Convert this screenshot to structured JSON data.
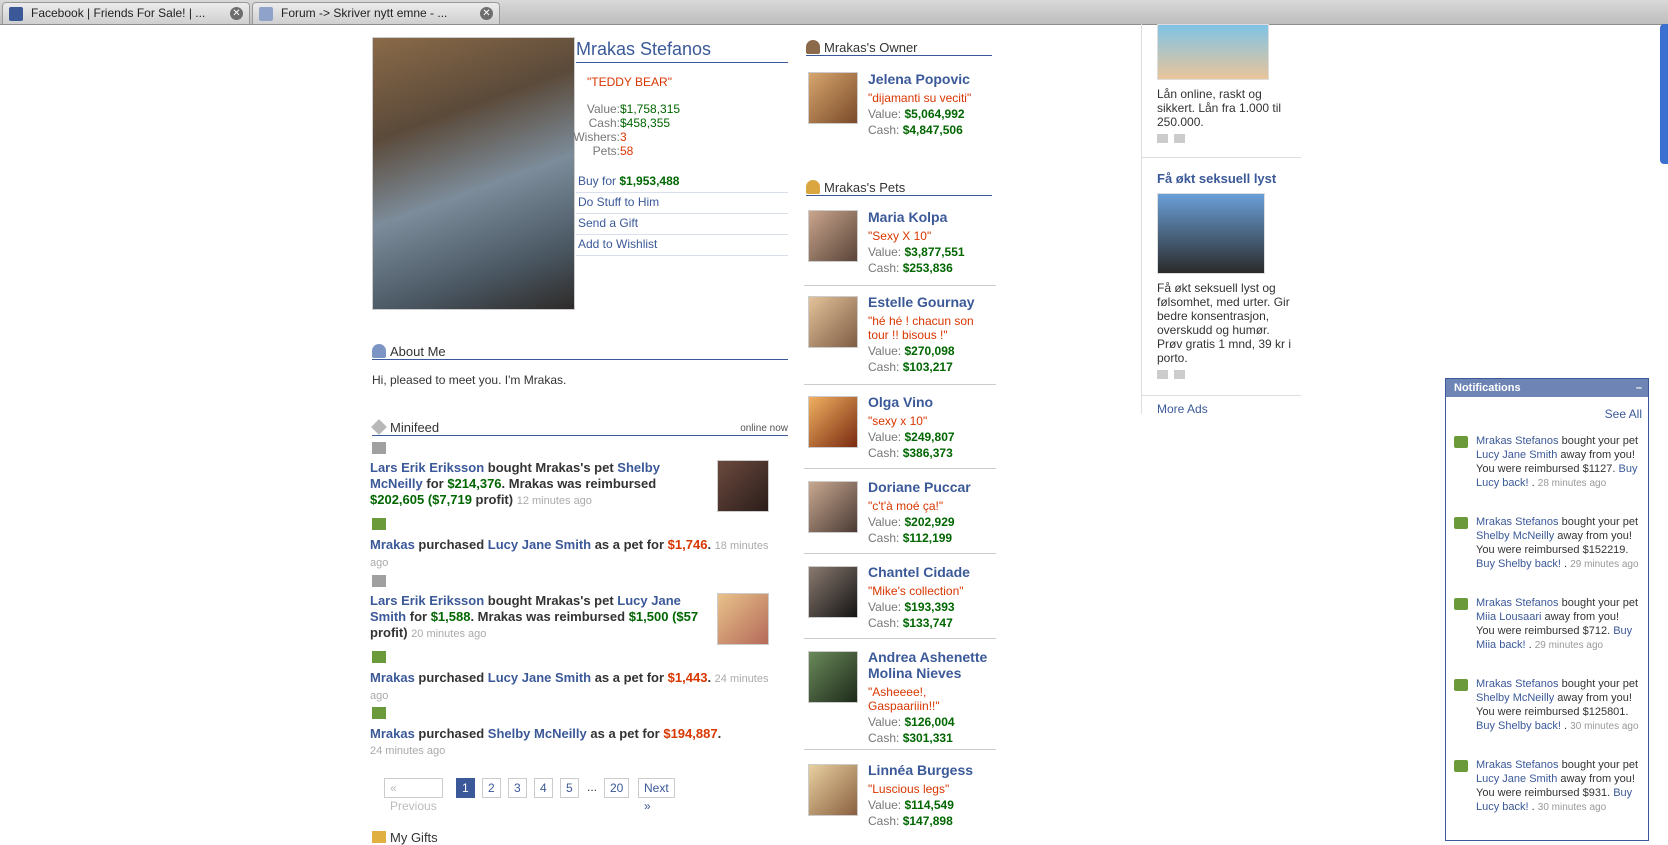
{
  "tabs": [
    {
      "title": "Facebook | Friends For Sale! | ..."
    },
    {
      "title": "Forum -> Skriver nytt emne - ..."
    }
  ],
  "profile": {
    "name": "Mrakas Stefanos",
    "nickname": "\"TEDDY BEAR\"",
    "stats": [
      {
        "label": "Value:",
        "value": "$1,758,315"
      },
      {
        "label": "Cash:",
        "value": "$458,355"
      },
      {
        "label": "Wishers:",
        "value": "3"
      },
      {
        "label": "Pets:",
        "value": "58"
      }
    ],
    "actions": {
      "buy_prefix": "Buy for ",
      "buy_price": "$1,953,488",
      "do_stuff": "Do Stuff to Him",
      "send_gift": "Send a Gift",
      "wishlist": "Add to Wishlist"
    }
  },
  "about": {
    "heading": "About Me",
    "text": "Hi, pleased to meet you. I'm Mrakas."
  },
  "minifeed": {
    "heading": "Minifeed",
    "status": "online now",
    "items": [
      {
        "actor": "Lars Erik Eriksson",
        "t1": " bought Mrakas's pet ",
        "pet": "Shelby McNeilly",
        "t2": " for ",
        "price": "$214,376",
        "t3": ". Mrakas was reimbursed ",
        "reimb": "$202,605 ($7,719",
        "t4": " profit) ",
        "ts": "12 minutes ago"
      },
      {
        "actor": "Mrakas",
        "t1": " purchased ",
        "pet": "Lucy Jane Smith",
        "t2": " as a pet for ",
        "price": "$1,746",
        "t3": ". ",
        "ts": "18 minutes ago"
      },
      {
        "actor": "Lars Erik Eriksson",
        "t1": " bought Mrakas's pet ",
        "pet": "Lucy Jane Smith",
        "t2": " for ",
        "price": "$1,588",
        "t3": ". Mrakas was reimbursed ",
        "reimb": "$1,500 ($57",
        "t4": " profit) ",
        "ts": "20 minutes ago"
      },
      {
        "actor": "Mrakas",
        "t1": " purchased ",
        "pet": "Lucy Jane Smith",
        "t2": " as a pet for ",
        "price": "$1,443",
        "t3": ". ",
        "ts": "24 minutes ago"
      },
      {
        "actor": "Mrakas",
        "t1": " purchased ",
        "pet": "Shelby McNeilly",
        "t2": " as a pet for ",
        "price": "$194,887",
        "t3": ".",
        "ts": "24 minutes ago"
      }
    ]
  },
  "pager": {
    "prev": "« Previous",
    "pages": [
      "1",
      "2",
      "3",
      "4",
      "5"
    ],
    "ellipsis": "...",
    "last": "20",
    "next": "Next »"
  },
  "gifts_heading": "My Gifts",
  "owner": {
    "heading": "Mrakas's Owner",
    "name": "Jelena Popovic",
    "quote": "\"dijamanti su veciti\"",
    "value_label": "Value:",
    "value": "$5,064,992",
    "cash_label": "Cash:",
    "cash": "$4,847,506"
  },
  "pets": {
    "heading": "Mrakas's Pets",
    "items": [
      {
        "name": "Maria Kolpa",
        "quote": "\"Sexy X 10\"",
        "value": "$3,877,551",
        "cash": "$253,836"
      },
      {
        "name": "Estelle Gournay",
        "quote": "\"hé hé ! chacun son tour !! bisous !\"",
        "value": "$270,098",
        "cash": "$103,217"
      },
      {
        "name": "Olga Vino",
        "quote": "\"sexy x 10\"",
        "value": "$249,807",
        "cash": "$386,373"
      },
      {
        "name": "Doriane Puccar",
        "quote": "\"c't'à moé ça!\"",
        "value": "$202,929",
        "cash": "$112,199"
      },
      {
        "name": "Chantel Cidade",
        "quote": "\"Mike's collection\"",
        "value": "$193,393",
        "cash": "$133,747"
      },
      {
        "name": "Andrea Ashenette Molina Nieves",
        "quote": "\"Asheeee!, Gaspaariiin!!\"",
        "value": "$126,004",
        "cash": "$301,331"
      },
      {
        "name": "Linnéa Burgess",
        "quote": "\"Luscious legs\"",
        "value": "$114,549",
        "cash": "$147,898"
      }
    ],
    "value_label": "Value:",
    "cash_label": "Cash:"
  },
  "ads": {
    "ad1_text": "Lån online, raskt og sikkert. Lån fra 1.000 til 250.000.",
    "ad2_title": "Få økt seksuell lyst",
    "ad2_text": "Få økt seksuell lyst og følsomhet, med urter. Gir bedre konsentrasjon, overskudd og humør. Prøv gratis 1 mnd, 39 kr i porto.",
    "more": "More Ads"
  },
  "notifications": {
    "heading": "Notifications",
    "minimize": "–",
    "see_all": "See All",
    "items": [
      {
        "actor": "Mrakas Stefanos",
        "t1": " bought your pet ",
        "pet": "Lucy Jane Smith",
        "t2": " away from you! You were reimbursed $1127. ",
        "link": "Buy Lucy back!",
        "t3": " . ",
        "ts": "28 minutes ago"
      },
      {
        "actor": "Mrakas Stefanos",
        "t1": " bought your pet ",
        "pet": "Shelby McNeilly",
        "t2": " away from you! You were reimbursed $152219. ",
        "link": "Buy Shelby back!",
        "t3": " . ",
        "ts": "29 minutes ago"
      },
      {
        "actor": "Mrakas Stefanos",
        "t1": " bought your pet ",
        "pet": "Miia Lousaari",
        "t2": " away from you! You were reimbursed $712. ",
        "link": "Buy Miia back!",
        "t3": " . ",
        "ts": "29 minutes ago"
      },
      {
        "actor": "Mrakas Stefanos",
        "t1": " bought your pet ",
        "pet": "Shelby McNeilly",
        "t2": " away from you! You were reimbursed $125801. ",
        "link": "Buy Shelby back!",
        "t3": " . ",
        "ts": "30 minutes ago"
      },
      {
        "actor": "Mrakas Stefanos",
        "t1": " bought your pet ",
        "pet": "Lucy Jane Smith",
        "t2": " away from you! You were reimbursed $931. ",
        "link": "Buy Lucy back!",
        "t3": " . ",
        "ts": "30 minutes ago"
      }
    ]
  }
}
